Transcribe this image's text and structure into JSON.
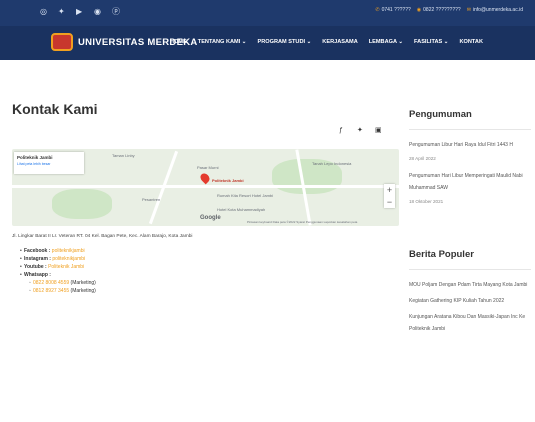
{
  "topbar": {
    "social_icons": [
      "instagram-icon",
      "twitter-icon",
      "youtube-icon",
      "whatsapp-icon",
      "pinterest-icon"
    ],
    "phone": "0741 ??????",
    "whatsapp": "0822 ?????????",
    "email": "info@unmerdeka.ac.id"
  },
  "nav": {
    "logo_text": "UNIVERSITAS MERDEKA",
    "items": [
      "HOME",
      "TENTANG KAMI ⌄",
      "PROGRAM STUDI ⌄",
      "KERJASAMA",
      "LEMBAGA ⌄",
      "FASILITAS ⌄",
      "KONTAK"
    ]
  },
  "main": {
    "title": "Kontak Kami",
    "share_icons": [
      "facebook-icon",
      "twitter-icon",
      "link-icon"
    ],
    "map": {
      "card_title": "Politeknik Jambi",
      "card_subtitle": "Lihat peta lebih besar",
      "labels": [
        "Taman Linby",
        "Pasar Murni",
        "Politeknik Jambi",
        "Rumah Kita Resort Hotel Jambi",
        "Tanah Lepo Indonesia",
        "Hotel Kota Muhammadiyah",
        "Pesantren"
      ],
      "google": "Google",
      "footer": "Pintasan keyboard  Data peta ©2022  Syarat Penggunaan  Laporkan kesalahan peta"
    },
    "address": "Jl. Lingkar Barat II Lr. Veteran RT. 04 Kel. Bagan Pete, Kec. Alam Barajo, Kota Jambi",
    "contacts": {
      "facebook_label": "Facebook :",
      "facebook_value": "politeknikjambi",
      "instagram_label": "Instagram :",
      "instagram_value": "politeknikjambi",
      "youtube_label": "Youtube :",
      "youtube_value": "Politeknik Jambi",
      "whatsapp_label": "Whatsapp :",
      "wa1_number": "0822 8008 4559",
      "wa1_note": "(Marketing)",
      "wa2_number": "0812 8927 3455",
      "wa2_note": "(Marketing)"
    }
  },
  "sidebar": {
    "pengumuman_title": "Pengumuman",
    "announcements": [
      {
        "title": "Pengumuman Libur Hari Raya Idul Fitri 1443 H",
        "date": "28 April 2022"
      },
      {
        "title": "Pengumuman Hari Libur Memperingati Maulid Nabi Muhammad SAW",
        "date": "18 Oktober 2021"
      }
    ],
    "populer_title": "Berita Populer",
    "populer": [
      "MOU Poljam Dengan Pdam Tirta Mayang Kota Jambi",
      "Kegiatan Gathering KIP Kuliah Tahun 2022",
      "Kunjungan Aratana Kibou Dan Massiki-Japan Inc Ke Politeknik Jambi"
    ]
  }
}
